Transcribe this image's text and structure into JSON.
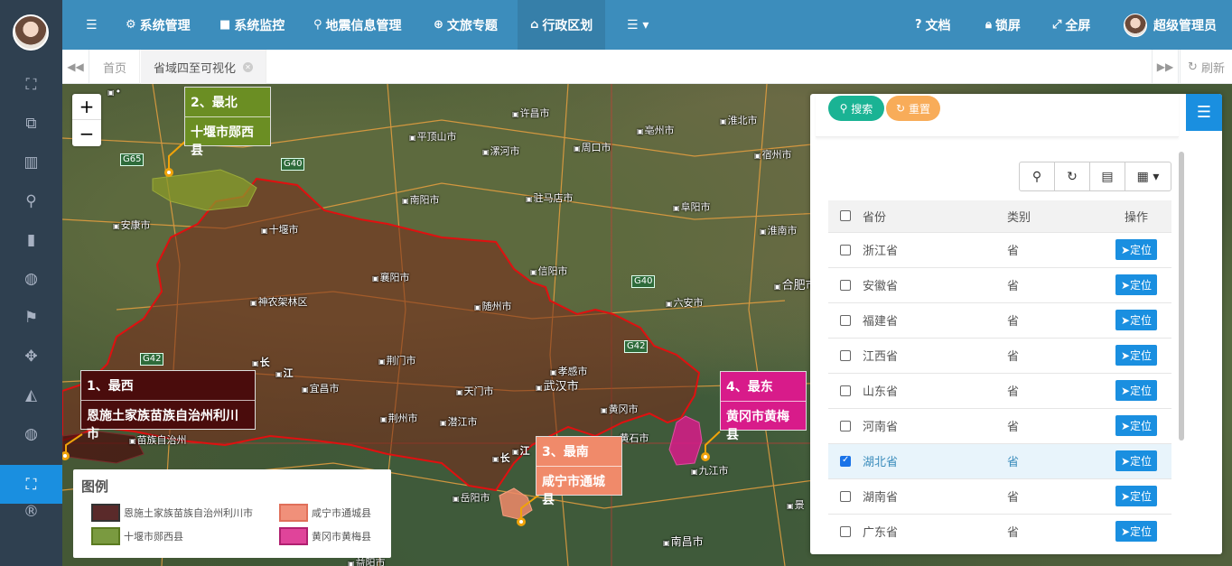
{
  "nav": {
    "items": [
      {
        "icon": "gear-icon",
        "label": "系统管理"
      },
      {
        "icon": "video-icon",
        "label": "系统监控"
      },
      {
        "icon": "map-marker-icon",
        "label": "地震信息管理"
      },
      {
        "icon": "globe-icon",
        "label": "文旅专题"
      },
      {
        "icon": "bank-icon",
        "label": "行政区划"
      }
    ],
    "right": {
      "docs": "文档",
      "lock": "锁屏",
      "fullscreen": "全屏",
      "user": "超级管理员"
    }
  },
  "tabs": {
    "home": "首页",
    "current": "省域四至可视化",
    "refresh": "刷新"
  },
  "map": {
    "zoom_in": "+",
    "zoom_out": "−",
    "cities": [
      "许昌市",
      "平顶山市",
      "漯河市",
      "周口市",
      "亳州市",
      "淮北市",
      "宿州市",
      "南阳市",
      "驻马店市",
      "阜阳市",
      "安康市",
      "十堰市",
      "襄阳市",
      "信阳市",
      "淮南市",
      "合肥市",
      "六安市",
      "神农架林区",
      "随州市",
      "荆门市",
      "孝感市",
      "宜昌市",
      "天门市",
      "武汉市",
      "黄冈市",
      "荆州市",
      "潜江市",
      "黄石市",
      "九江市",
      "苗族自治州",
      "岳阳市",
      "南昌市",
      "益阳市",
      "景"
    ],
    "highways": [
      "G65",
      "G40",
      "G40",
      "G42",
      "G42"
    ],
    "river": [
      "长",
      "江",
      "长",
      "江"
    ],
    "callouts": {
      "north": {
        "title": "2、最北",
        "name": "十堰市郧西县",
        "color": "#6b8e23"
      },
      "west": {
        "title": "1、最西",
        "name": "恩施土家族苗族自治州利川市",
        "color": "#4a0c0c"
      },
      "south": {
        "title": "3、最南",
        "name": "咸宁市通城县",
        "color": "#f08a6a"
      },
      "east": {
        "title": "4、最东",
        "name": "黄冈市黄梅县",
        "color": "#d81b8a"
      }
    }
  },
  "legend": {
    "title": "图例",
    "items": [
      {
        "label": "恩施土家族苗族自治州利川市",
        "color": "#5a2a2a"
      },
      {
        "label": "咸宁市通城县",
        "color": "#f0907a"
      },
      {
        "label": "十堰市郧西县",
        "color": "#7a9a40"
      },
      {
        "label": "黄冈市黄梅县",
        "color": "#e0449a"
      }
    ]
  },
  "panel": {
    "search": "搜索",
    "reset": "重置",
    "columns": {
      "province": "省份",
      "type": "类别",
      "action": "操作"
    },
    "locate": "定位",
    "rows": [
      {
        "name": "浙江省",
        "type": "省",
        "checked": false
      },
      {
        "name": "安徽省",
        "type": "省",
        "checked": false
      },
      {
        "name": "福建省",
        "type": "省",
        "checked": false
      },
      {
        "name": "江西省",
        "type": "省",
        "checked": false
      },
      {
        "name": "山东省",
        "type": "省",
        "checked": false
      },
      {
        "name": "河南省",
        "type": "省",
        "checked": false
      },
      {
        "name": "湖北省",
        "type": "省",
        "checked": true
      },
      {
        "name": "湖南省",
        "type": "省",
        "checked": false
      },
      {
        "name": "广东省",
        "type": "省",
        "checked": false
      }
    ]
  }
}
